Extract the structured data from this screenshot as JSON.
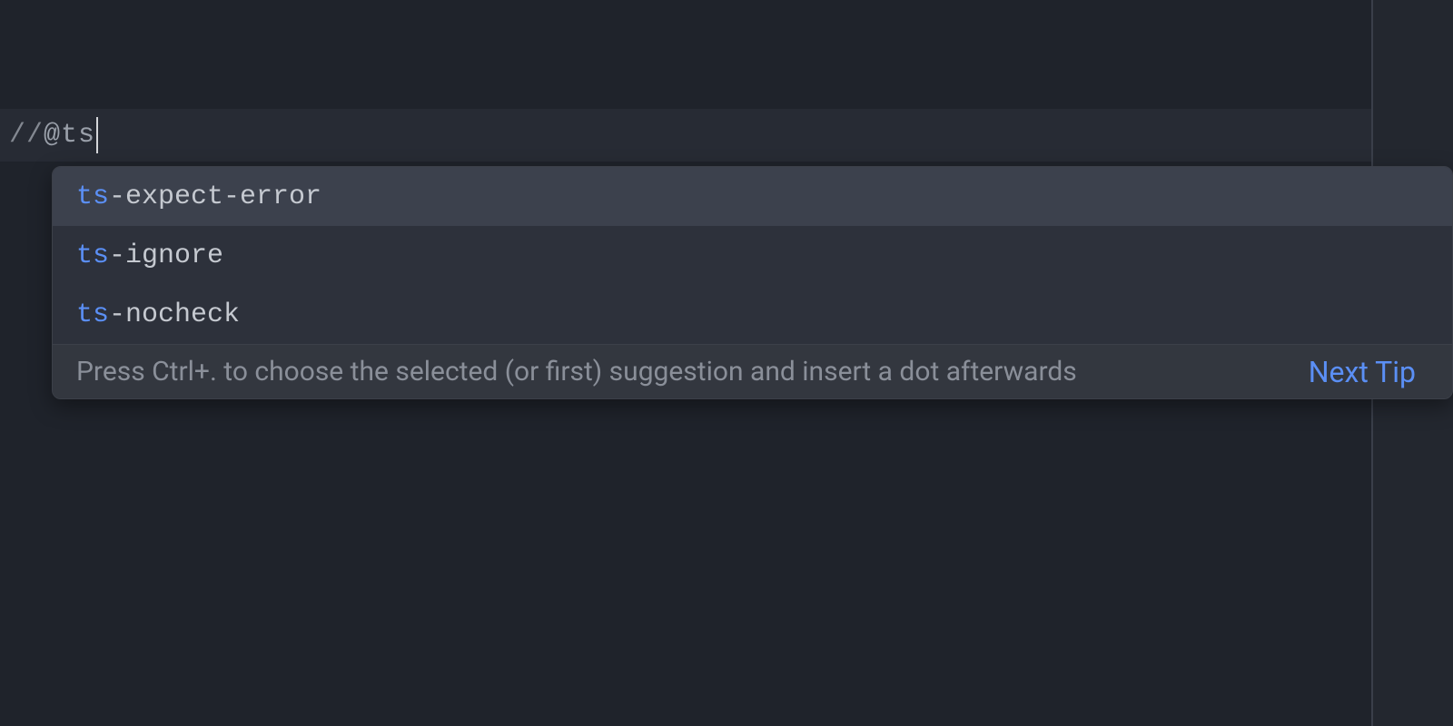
{
  "editor": {
    "current_line_prefix": "//",
    "current_line_annotation": "@ts"
  },
  "autocomplete": {
    "matched_prefix": "ts",
    "suggestions": [
      {
        "rest": "-expect-error",
        "selected": true
      },
      {
        "rest": "-ignore",
        "selected": false
      },
      {
        "rest": "-nocheck",
        "selected": false
      }
    ],
    "tip": "Press Ctrl+. to choose the selected (or first) suggestion and insert a dot afterwards",
    "next_tip_label": "Next Tip"
  }
}
